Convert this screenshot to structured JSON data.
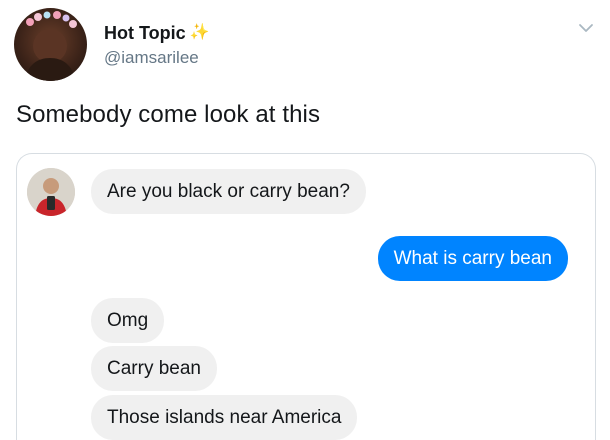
{
  "tweet": {
    "display_name": "Hot Topic",
    "name_emoji": "✨",
    "handle": "@iamsarilee",
    "text": "Somebody come look at this"
  },
  "icons": {
    "sparkle": "sparkle-icon",
    "chevron": "chevron-down-icon"
  },
  "chat": {
    "messages": [
      {
        "side": "incoming",
        "text": "Are you black or carry bean?"
      },
      {
        "side": "outgoing",
        "text": "What is carry bean"
      },
      {
        "side": "incoming",
        "text": "Omg"
      },
      {
        "side": "incoming",
        "text": "Carry bean"
      },
      {
        "side": "incoming",
        "text": "Those islands near America"
      }
    ]
  },
  "colors": {
    "outgoing_bubble": "#0084ff",
    "incoming_bubble": "#f0f0f0",
    "handle_text": "#657786",
    "sparkle": "#f2c94c"
  }
}
